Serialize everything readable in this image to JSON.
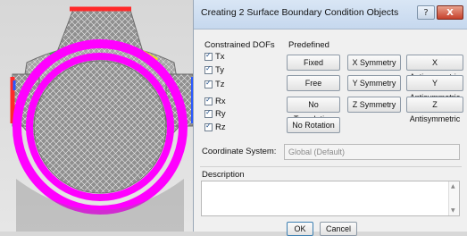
{
  "dialog": {
    "title": "Creating 2 Surface Boundary Condition Objects",
    "help_label": "?",
    "close_label": "X"
  },
  "constrained": {
    "heading": "Constrained DOFs",
    "items": [
      {
        "label": "Tx",
        "checked": true
      },
      {
        "label": "Ty",
        "checked": true
      },
      {
        "label": "Tz",
        "checked": true
      },
      {
        "label": "Rx",
        "checked": true
      },
      {
        "label": "Ry",
        "checked": true
      },
      {
        "label": "Rz",
        "checked": true
      }
    ]
  },
  "predefined": {
    "heading": "Predefined",
    "fixed": "Fixed",
    "x_symmetry": "X Symmetry",
    "x_antisymmetric": "X Antisymmetric",
    "free": "Free",
    "y_symmetry": "Y Symmetry",
    "y_antisymmetric": "Y Antisymmetric",
    "no_translation": "No Translation",
    "z_symmetry": "Z Symmetry",
    "z_antisymmetric": "Z Antisymmetric",
    "no_rotation": "No Rotation"
  },
  "coordinate": {
    "label": "Coordinate System:",
    "value": "Global (Default)"
  },
  "description": {
    "label": "Description",
    "value": ""
  },
  "footer": {
    "ok": "OK",
    "cancel": "Cancel"
  },
  "colors": {
    "mesh_fill": "#9b9b9b",
    "mesh_line": "#e8e8e8",
    "magenta": "#ff00ff",
    "red": "#ff2a2a",
    "green": "#26d13a",
    "yellow": "#f1df1f",
    "blue": "#2a58ff"
  }
}
